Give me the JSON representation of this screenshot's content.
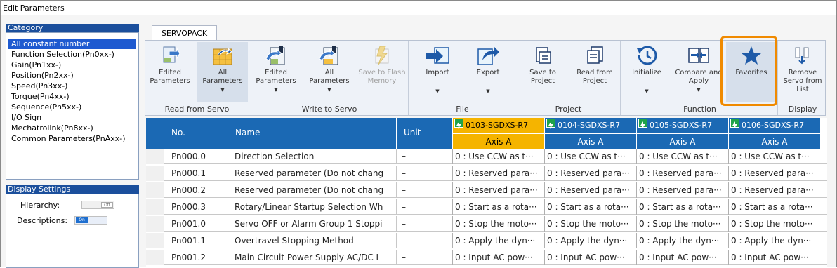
{
  "window": {
    "title": "Edit Parameters"
  },
  "category": {
    "header": "Category",
    "items": [
      "All constant number",
      "Function Selection(Pn0xx-)",
      "Gain(Pn1xx-)",
      "Position(Pn2xx-)",
      "Speed(Pn3xx-)",
      "Torque(Pn4xx-)",
      "Sequence(Pn5xx-)",
      "I/O Sign",
      "Mechatrolink(Pn8xx-)",
      "Common Parameters(PnAxx-)"
    ],
    "selected_index": 0
  },
  "display_settings": {
    "header": "Display Settings",
    "hierarchy_label": "Hierarchy:",
    "hierarchy_state": "Off",
    "descriptions_label": "Descriptions:",
    "descriptions_state": "On"
  },
  "ribbon": {
    "tab": "SERVOPACK",
    "groups": {
      "read_from_servo": {
        "label": "Read from Servo",
        "edited": "Edited Parameters",
        "all": "All Parameters"
      },
      "write_to_servo": {
        "label": "Write to Servo",
        "edited": "Edited Parameters",
        "all": "All Parameters",
        "flash": "Save to Flash Memory"
      },
      "file": {
        "label": "File",
        "import": "Import",
        "export": "Export"
      },
      "project": {
        "label": "Project",
        "save": "Save to Project",
        "read": "Read from Project"
      },
      "function": {
        "label": "Function",
        "initialize": "Initialize",
        "compare": "Compare and Apply",
        "favorites": "Favorites"
      },
      "display": {
        "label": "Display",
        "remove": "Remove Servo from List"
      }
    }
  },
  "table": {
    "headers": {
      "no": "No.",
      "name": "Name",
      "unit": "Unit"
    },
    "devices": [
      {
        "name": "0103-SGDXS-R7",
        "axis": "Axis A"
      },
      {
        "name": "0104-SGDXS-R7",
        "axis": "Axis A"
      },
      {
        "name": "0105-SGDXS-R7",
        "axis": "Axis A"
      },
      {
        "name": "0106-SGDXS-R7",
        "axis": "Axis A"
      }
    ],
    "rows": [
      {
        "no": "Pn000.0",
        "name": "Direction Selection",
        "unit": "–",
        "value": "0 : Use CCW as t···"
      },
      {
        "no": "Pn000.1",
        "name": "Reserved parameter (Do not chang",
        "unit": "–",
        "value": "0 : Reserved para···"
      },
      {
        "no": "Pn000.2",
        "name": "Reserved parameter (Do not chang",
        "unit": "–",
        "value": "0 : Reserved para···"
      },
      {
        "no": "Pn000.3",
        "name": "Rotary/Linear Startup Selection Wh",
        "unit": "–",
        "value": "0 : Start as a rota···"
      },
      {
        "no": "Pn001.0",
        "name": "Servo OFF or Alarm Group 1 Stoppi",
        "unit": "–",
        "value": "0 : Stop the moto···"
      },
      {
        "no": "Pn001.1",
        "name": "Overtravel Stopping Method",
        "unit": "–",
        "value": "0 : Apply the dyn···"
      },
      {
        "no": "Pn001.2",
        "name": "Main Circuit Power Supply AC/DC I",
        "unit": "–",
        "value": "0 : Input AC pow···"
      }
    ]
  },
  "colors": {
    "header_blue": "#1b69b4",
    "selected_axis": "#f5b400",
    "favorites_highlight": "#f08a00"
  }
}
